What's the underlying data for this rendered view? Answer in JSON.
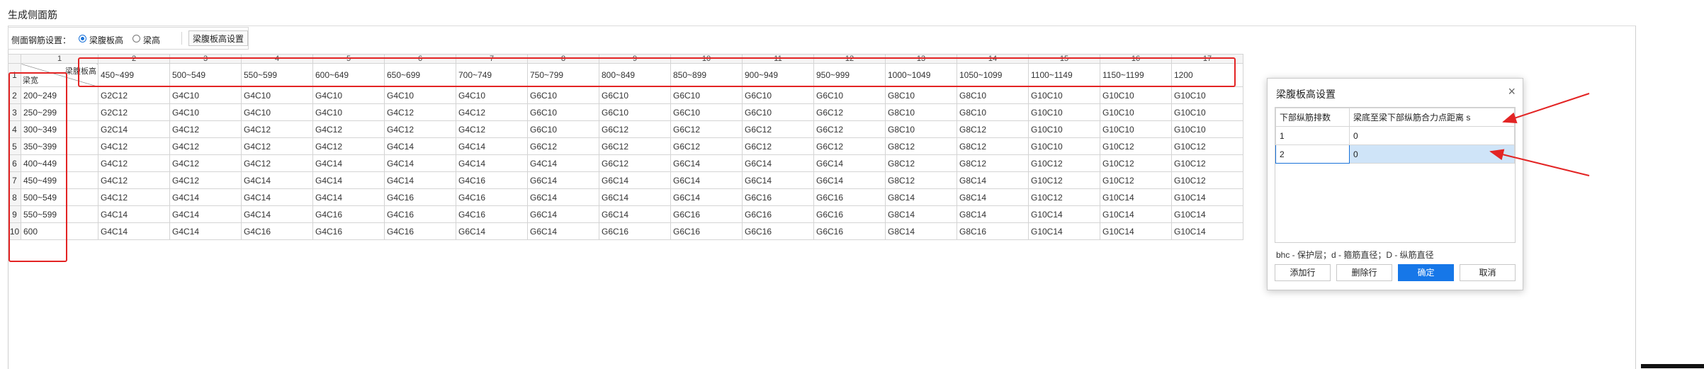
{
  "window_title": "生成侧面筋",
  "toolbar": {
    "label": "侧面钢筋设置：",
    "radio1": "梁腹板高",
    "radio2": "梁高",
    "button": "梁腹板高设置"
  },
  "grid": {
    "col_numbers": [
      "1",
      "2",
      "3",
      "4",
      "5",
      "6",
      "7",
      "8",
      "9",
      "10",
      "11",
      "12",
      "13",
      "14",
      "15",
      "16",
      "17"
    ],
    "corner_top": "梁腹板高",
    "corner_bottom": "梁宽",
    "headers": [
      "450~499",
      "500~549",
      "550~599",
      "600~649",
      "650~699",
      "700~749",
      "750~799",
      "800~849",
      "850~899",
      "900~949",
      "950~999",
      "1000~1049",
      "1050~1099",
      "1100~1149",
      "1150~1199",
      "1200"
    ],
    "rows": [
      {
        "num": "2",
        "width": "200~249",
        "cells": [
          "G2C12",
          "G4C10",
          "G4C10",
          "G4C10",
          "G4C10",
          "G4C10",
          "G6C10",
          "G6C10",
          "G6C10",
          "G6C10",
          "G6C10",
          "G8C10",
          "G8C10",
          "G10C10",
          "G10C10",
          "G10C10"
        ]
      },
      {
        "num": "3",
        "width": "250~299",
        "cells": [
          "G2C12",
          "G4C10",
          "G4C10",
          "G4C10",
          "G4C12",
          "G4C12",
          "G6C10",
          "G6C10",
          "G6C10",
          "G6C10",
          "G6C12",
          "G8C10",
          "G8C10",
          "G10C10",
          "G10C10",
          "G10C10"
        ]
      },
      {
        "num": "4",
        "width": "300~349",
        "cells": [
          "G2C14",
          "G4C12",
          "G4C12",
          "G4C12",
          "G4C12",
          "G4C12",
          "G6C10",
          "G6C12",
          "G6C12",
          "G6C12",
          "G6C12",
          "G8C10",
          "G8C12",
          "G10C10",
          "G10C10",
          "G10C10"
        ]
      },
      {
        "num": "5",
        "width": "350~399",
        "cells": [
          "G4C12",
          "G4C12",
          "G4C12",
          "G4C12",
          "G4C14",
          "G4C14",
          "G6C12",
          "G6C12",
          "G6C12",
          "G6C12",
          "G6C12",
          "G8C12",
          "G8C12",
          "G10C10",
          "G10C12",
          "G10C12"
        ]
      },
      {
        "num": "6",
        "width": "400~449",
        "cells": [
          "G4C12",
          "G4C12",
          "G4C12",
          "G4C14",
          "G4C14",
          "G4C14",
          "G4C14",
          "G6C12",
          "G6C14",
          "G6C14",
          "G6C14",
          "G8C12",
          "G8C12",
          "G10C12",
          "G10C12",
          "G10C12"
        ]
      },
      {
        "num": "7",
        "width": "450~499",
        "cells": [
          "G4C12",
          "G4C12",
          "G4C14",
          "G4C14",
          "G4C14",
          "G4C16",
          "G6C14",
          "G6C14",
          "G6C14",
          "G6C14",
          "G6C14",
          "G8C12",
          "G8C14",
          "G10C12",
          "G10C12",
          "G10C12"
        ]
      },
      {
        "num": "8",
        "width": "500~549",
        "cells": [
          "G4C12",
          "G4C14",
          "G4C14",
          "G4C14",
          "G4C16",
          "G4C16",
          "G6C14",
          "G6C14",
          "G6C14",
          "G6C16",
          "G6C16",
          "G8C14",
          "G8C14",
          "G10C12",
          "G10C14",
          "G10C14"
        ]
      },
      {
        "num": "9",
        "width": "550~599",
        "cells": [
          "G4C14",
          "G4C14",
          "G4C14",
          "G4C16",
          "G4C16",
          "G4C16",
          "G6C14",
          "G6C14",
          "G6C16",
          "G6C16",
          "G6C16",
          "G8C14",
          "G8C14",
          "G10C14",
          "G10C14",
          "G10C14"
        ]
      },
      {
        "num": "10",
        "width": "600",
        "cells": [
          "G4C14",
          "G4C14",
          "G4C16",
          "G4C16",
          "G4C16",
          "G6C14",
          "G6C14",
          "G6C16",
          "G6C16",
          "G6C16",
          "G6C16",
          "G8C14",
          "G8C16",
          "G10C14",
          "G10C14",
          "G10C14"
        ]
      }
    ]
  },
  "dialog": {
    "title": "梁腹板高设置",
    "close": "×",
    "col1": "下部纵筋排数",
    "col2": "梁底至梁下部纵筋合力点距离 s",
    "rows": [
      {
        "a": "1",
        "b": "0"
      },
      {
        "a": "2",
        "b": "0"
      }
    ],
    "note": "bhc - 保护层；d - 箍筋直径；D - 纵筋直径",
    "add_row": "添加行",
    "delete_row": "删除行",
    "ok": "确定",
    "cancel": "取消"
  },
  "colors": {
    "annotation_red": "#e32424",
    "primary_blue": "#1677e8",
    "selection": "#cfe4f8"
  }
}
